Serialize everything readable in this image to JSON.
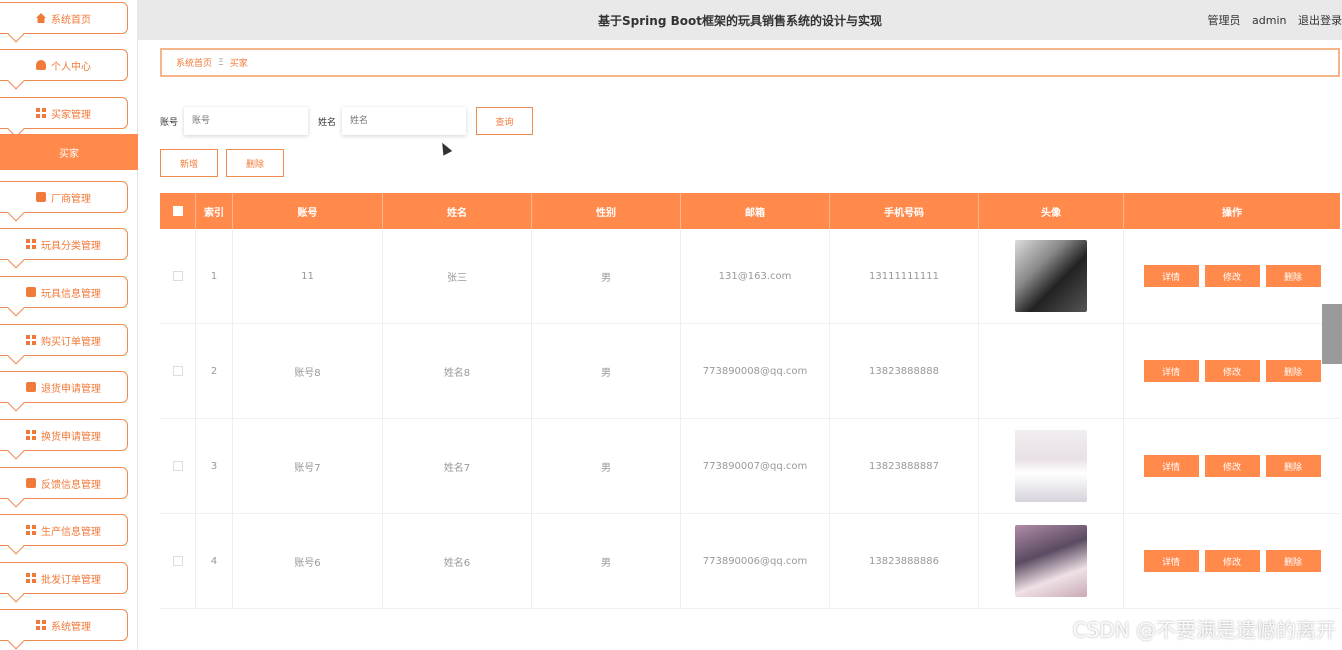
{
  "header": {
    "title": "基于Spring Boot框架的玩具销售系统的设计与实现",
    "user_role": "管理员",
    "user_name": "admin",
    "logout": "退出登录"
  },
  "sidebar": {
    "items": [
      {
        "label": "系统首页",
        "icon": "home-icon"
      },
      {
        "label": "个人中心",
        "icon": "user-icon"
      },
      {
        "label": "买家管理",
        "icon": "grid-icon"
      },
      {
        "label": "买家",
        "icon": "",
        "active": true
      },
      {
        "label": "厂商管理",
        "icon": "factory-icon"
      },
      {
        "label": "玩具分类管理",
        "icon": "grid-icon"
      },
      {
        "label": "玩具信息管理",
        "icon": "box-icon"
      },
      {
        "label": "购买订单管理",
        "icon": "grid-icon"
      },
      {
        "label": "退货申请管理",
        "icon": "box-icon"
      },
      {
        "label": "换货申请管理",
        "icon": "grid-icon"
      },
      {
        "label": "反馈信息管理",
        "icon": "box-icon"
      },
      {
        "label": "生产信息管理",
        "icon": "grid-icon"
      },
      {
        "label": "批发订单管理",
        "icon": "grid-icon"
      },
      {
        "label": "系统管理",
        "icon": "grid-icon"
      }
    ]
  },
  "breadcrumb": {
    "home": "系统首页",
    "separator": "Ξ",
    "current": "买家"
  },
  "search": {
    "account_label": "账号",
    "account_placeholder": "账号",
    "name_label": "姓名",
    "name_placeholder": "姓名",
    "query_button": "查询"
  },
  "actions": {
    "add": "新增",
    "delete": "删除"
  },
  "table": {
    "headers": [
      "索引",
      "账号",
      "姓名",
      "性别",
      "邮箱",
      "手机号码",
      "头像",
      "操作"
    ],
    "rows": [
      {
        "index": "1",
        "account": "11",
        "name": "张三",
        "gender": "男",
        "email": "131@163.com",
        "phone": "13111111111"
      },
      {
        "index": "2",
        "account": "账号8",
        "name": "姓名8",
        "gender": "男",
        "email": "773890008@qq.com",
        "phone": "13823888888"
      },
      {
        "index": "3",
        "account": "账号7",
        "name": "姓名7",
        "gender": "男",
        "email": "773890007@qq.com",
        "phone": "13823888887"
      },
      {
        "index": "4",
        "account": "账号6",
        "name": "姓名6",
        "gender": "男",
        "email": "773890006@qq.com",
        "phone": "13823888886"
      }
    ],
    "op_detail": "详情",
    "op_edit": "修改",
    "op_delete": "删除"
  },
  "watermark": "CSDN @不要满是遗憾的离开",
  "colors": {
    "accent": "#ff8a4c",
    "accent_border": "#f08b50",
    "header_bg": "#e9e9e9"
  }
}
